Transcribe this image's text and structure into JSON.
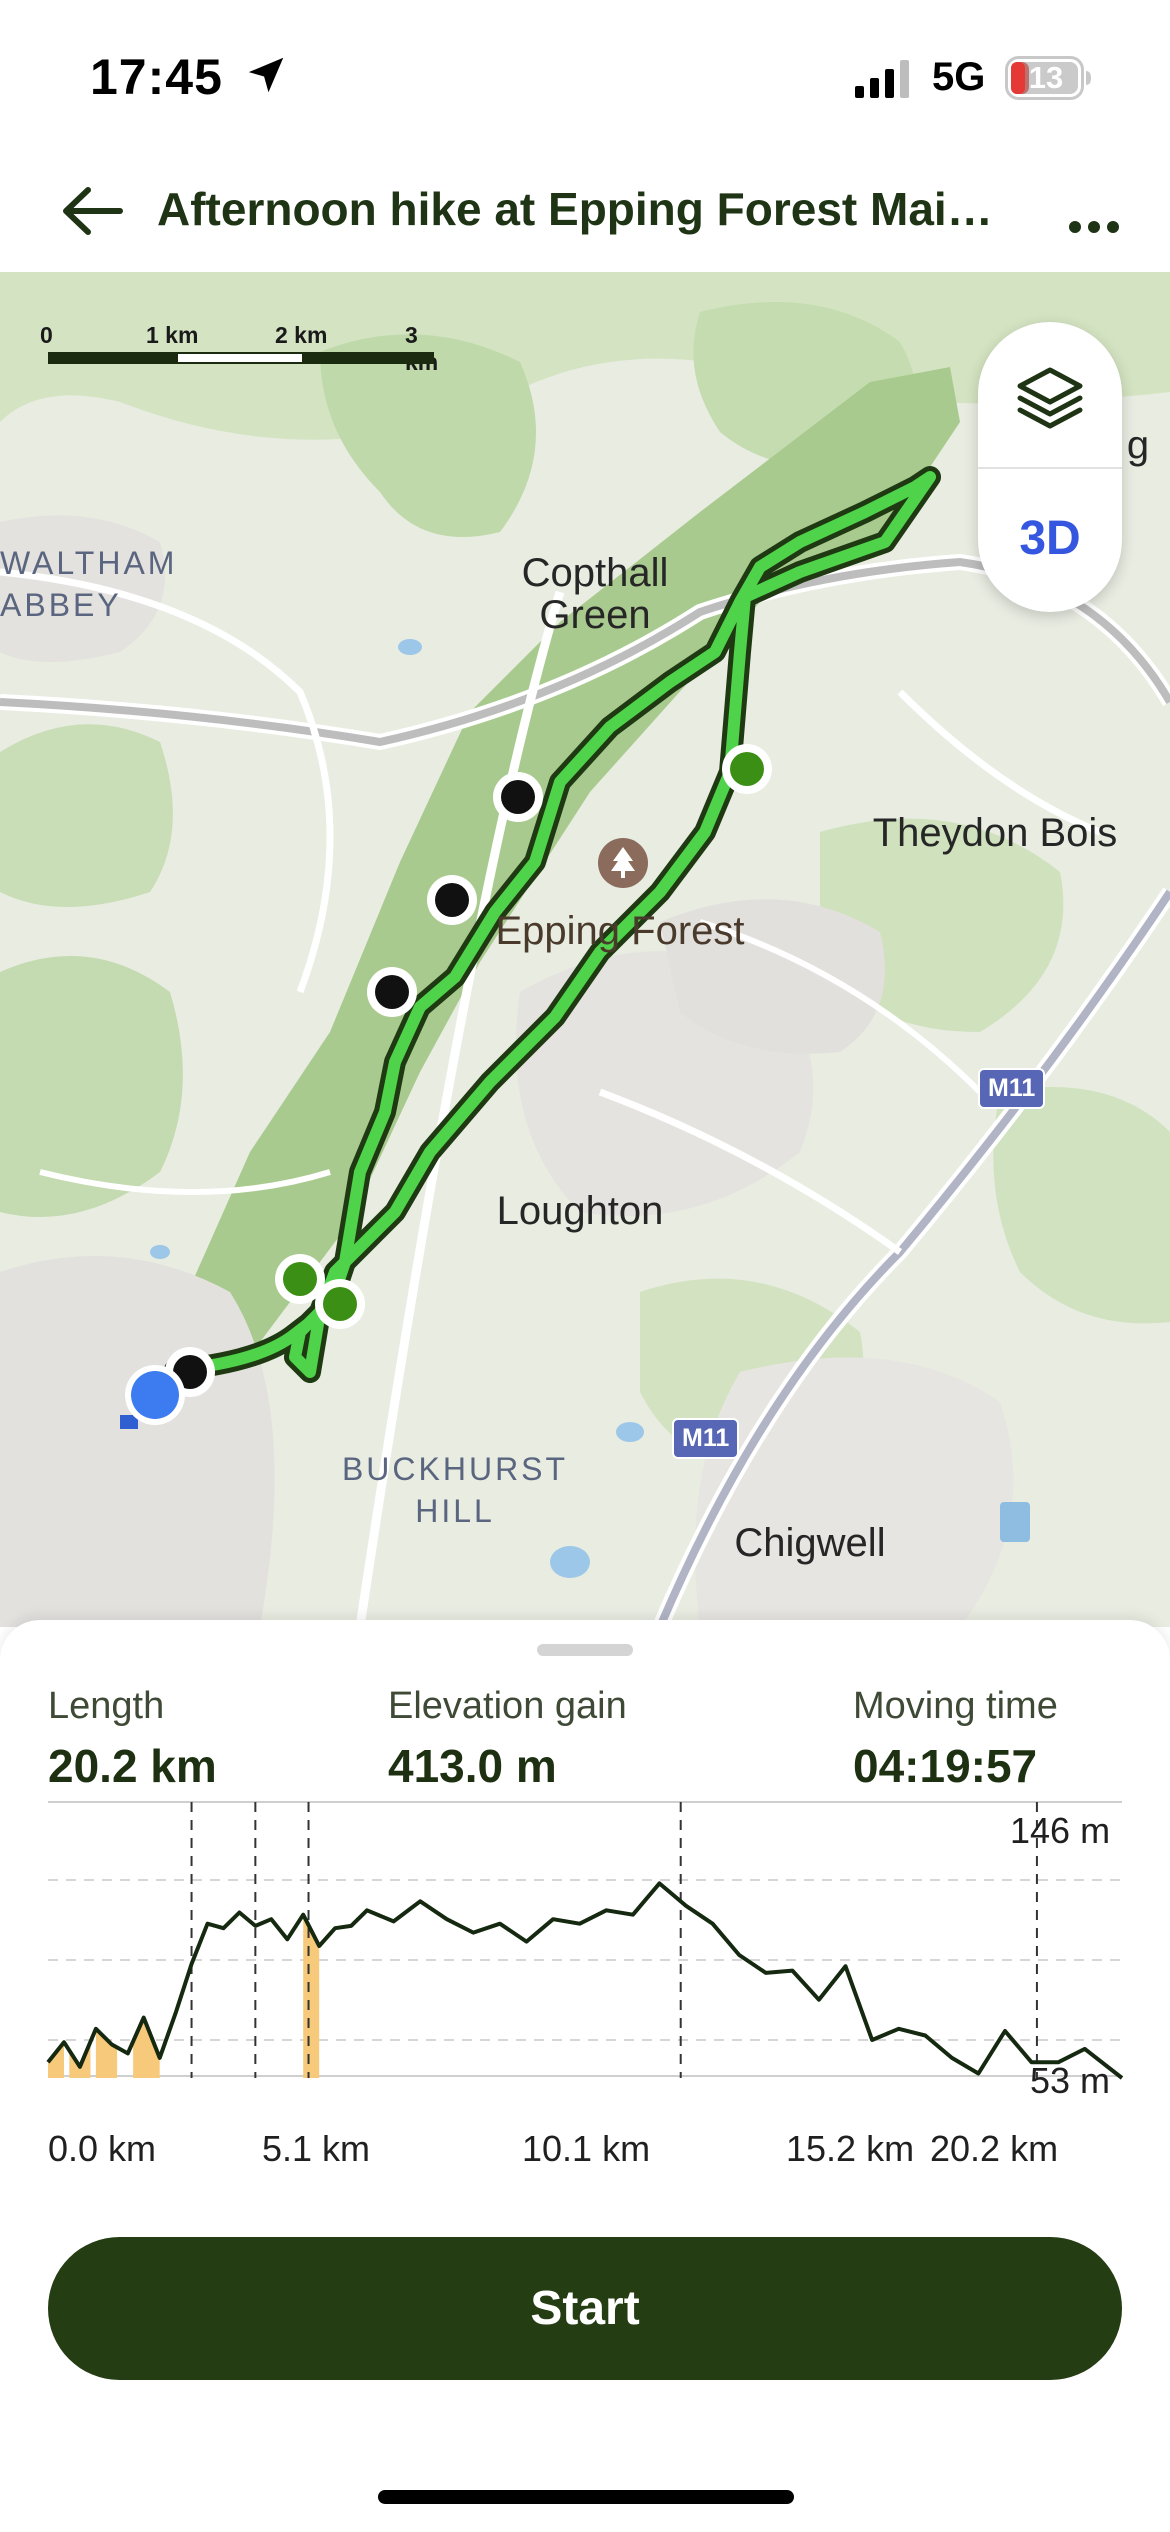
{
  "status_bar": {
    "time": "17:45",
    "network": "5G",
    "battery": "13",
    "icons": [
      "location-arrow-icon",
      "signal-icon",
      "battery-icon"
    ]
  },
  "header": {
    "title": "Afternoon hike at Epping Forest Mai…",
    "back_icon": "arrow-left-icon",
    "more_icon": "more-horizontal-icon"
  },
  "map": {
    "scale": {
      "labels": [
        "0",
        "1 km",
        "2 km",
        "3 km"
      ]
    },
    "controls": {
      "layers_icon": "layers-icon",
      "label_3d": "3D"
    },
    "labels": {
      "waltham_abbey": "WALTHAM\nABBEY",
      "copthall_green": "Copthall\nGreen",
      "theydon_bois": "Theydon Bois",
      "epping_forest": "Epping Forest",
      "loughton": "Loughton",
      "buckhurst_hill": "BUCKHURST\nHILL",
      "chigwell": "Chigwell",
      "edge_g": "g"
    },
    "motorway_labels": [
      "M11",
      "M11"
    ],
    "poi_icon": "tree-icon",
    "colors": {
      "route": "#4fd34a",
      "route_outline": "#1f3a12",
      "waypoint_black": "#111111",
      "waypoint_green": "#3b8f14",
      "current_location": "#3d7cf0"
    }
  },
  "stats": {
    "length": {
      "label": "Length",
      "value": "20.2 km"
    },
    "elevation_gain": {
      "label": "Elevation gain",
      "value": "413.0 m"
    },
    "moving_time": {
      "label": "Moving time",
      "value": "04:19:57"
    }
  },
  "chart_data": {
    "type": "area",
    "title": "",
    "xlabel": "",
    "ylabel": "",
    "x_tick_labels": [
      "0.0 km",
      "5.1 km",
      "10.1 km",
      "15.2 km",
      "20.2 km"
    ],
    "y_labels": {
      "max": "146 m",
      "min": "53 m"
    },
    "xlim": [
      0,
      20.2
    ],
    "ylim": [
      53,
      146
    ],
    "grid": "horizontal dashed",
    "series": [
      {
        "x": [
          0,
          0.3,
          0.6,
          0.9,
          1.2,
          1.5,
          1.8,
          2.1,
          2.4,
          2.7,
          3.0,
          3.3,
          3.6,
          3.9,
          4.2,
          4.5,
          4.8,
          5.1,
          5.4,
          5.7,
          6.0,
          6.5,
          7.0,
          7.5,
          8.0,
          8.5,
          9.0,
          9.5,
          10.0,
          10.5,
          11.0,
          11.5,
          12.0,
          12.5,
          13.0,
          13.5,
          14.0,
          14.5,
          15.0,
          15.5,
          16.0,
          16.5,
          17.0,
          17.5,
          18.0,
          18.5,
          19.0,
          19.5,
          20.2
        ],
        "y": [
          60,
          69,
          58,
          75,
          68,
          64,
          80,
          62,
          82,
          104,
          122,
          120,
          127,
          121,
          124,
          115,
          126,
          112,
          120,
          121,
          128,
          123,
          132,
          124,
          118,
          122,
          114,
          124,
          122,
          128,
          126,
          140,
          130,
          122,
          108,
          100,
          101,
          88,
          103,
          70,
          75,
          72,
          62,
          55,
          74,
          60,
          60,
          66,
          53
        ]
      }
    ],
    "highlight_ranges_km": [
      [
        0,
        0.3
      ],
      [
        0.4,
        0.8
      ],
      [
        0.9,
        1.3
      ],
      [
        1.6,
        2.1
      ],
      [
        4.8,
        5.1
      ]
    ],
    "waypoint_markers_km": [
      2.7,
      3.9,
      4.9,
      11.9,
      18.6
    ],
    "colors": {
      "line": "#152810",
      "highlight": "#f7c97b",
      "marker": "#333333"
    }
  },
  "start_button": {
    "label": "Start"
  }
}
